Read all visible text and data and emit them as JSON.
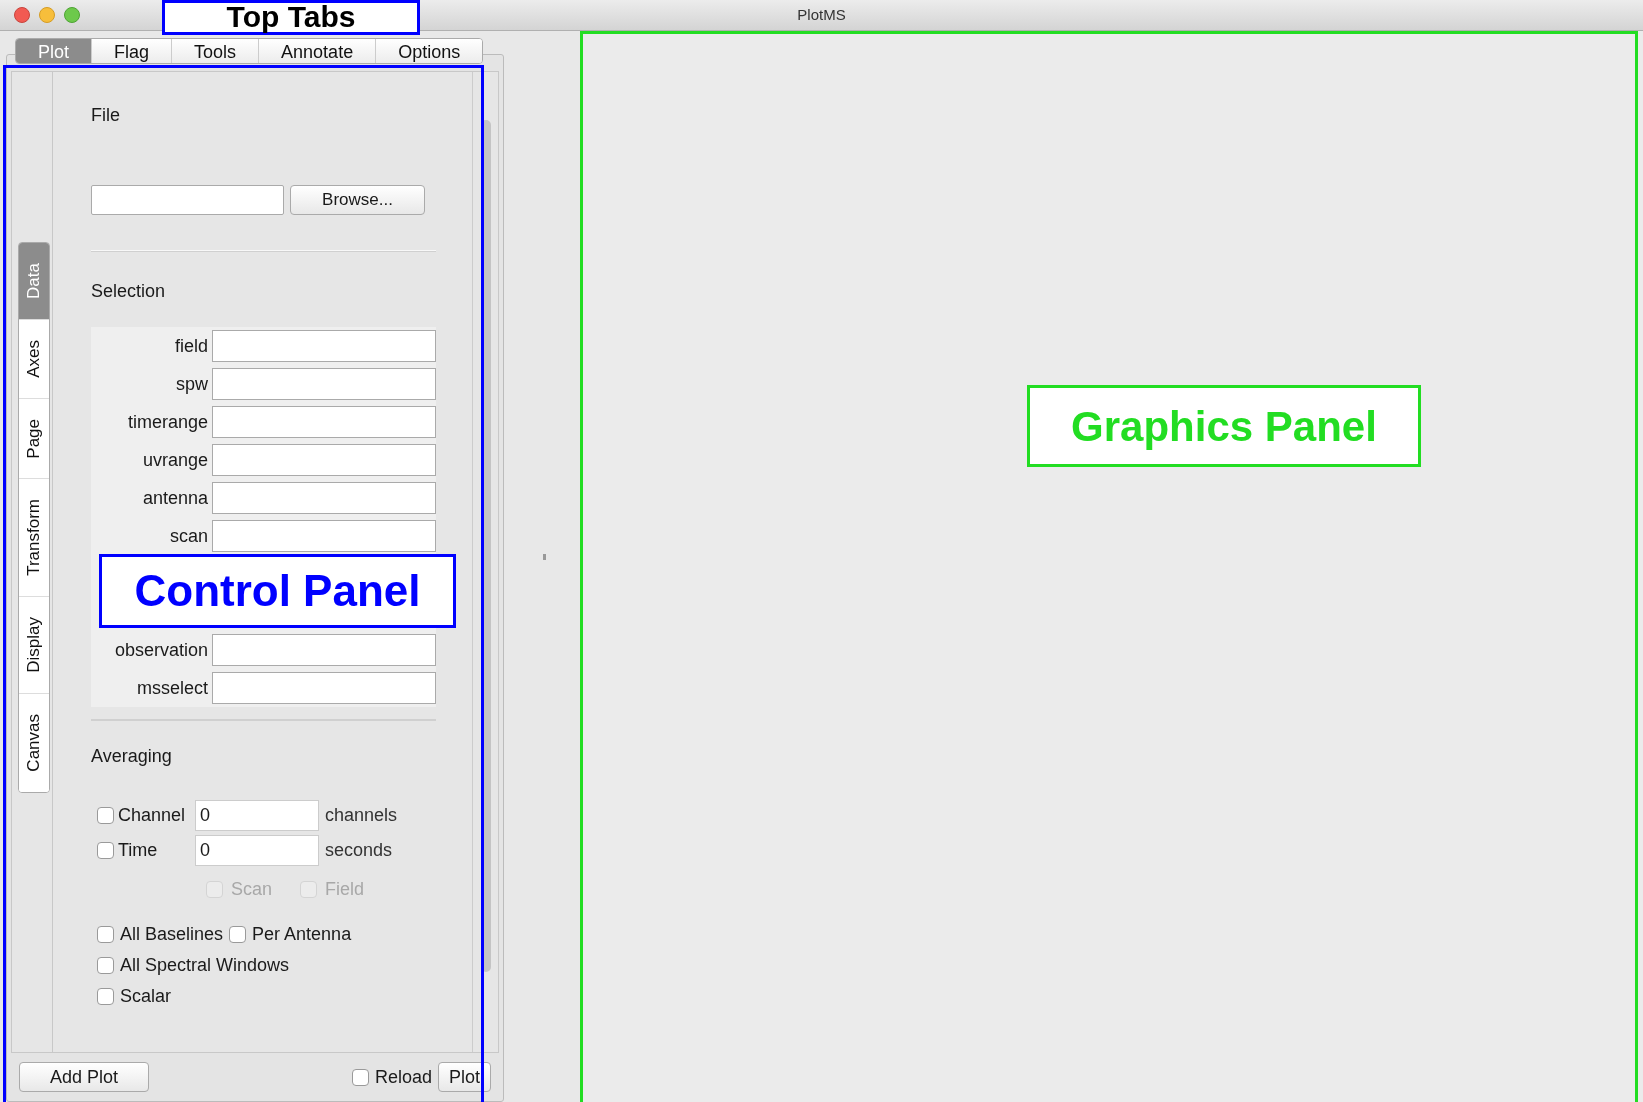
{
  "window": {
    "title": "PlotMS"
  },
  "top_tabs": [
    {
      "label": "Plot",
      "selected": true
    },
    {
      "label": "Flag",
      "selected": false
    },
    {
      "label": "Tools",
      "selected": false
    },
    {
      "label": "Annotate",
      "selected": false
    },
    {
      "label": "Options",
      "selected": false
    }
  ],
  "side_tabs": [
    {
      "label": "Data",
      "selected": true
    },
    {
      "label": "Axes",
      "selected": false
    },
    {
      "label": "Page",
      "selected": false
    },
    {
      "label": "Transform",
      "selected": false
    },
    {
      "label": "Display",
      "selected": false
    },
    {
      "label": "Canvas",
      "selected": false
    }
  ],
  "file_section": {
    "heading": "File",
    "button": "Browse..."
  },
  "selection": {
    "heading": "Selection",
    "fields": [
      {
        "label": "field"
      },
      {
        "label": "spw"
      },
      {
        "label": "timerange"
      },
      {
        "label": "uvrange"
      },
      {
        "label": "antenna"
      },
      {
        "label": "scan"
      },
      {
        "label": "observation"
      },
      {
        "label": "msselect"
      }
    ]
  },
  "averaging": {
    "heading": "Averaging",
    "rows": [
      {
        "label": "Channel",
        "checked": false,
        "value": "0",
        "unit": "channels"
      },
      {
        "label": "Time",
        "checked": false,
        "value": "0",
        "unit": "seconds"
      }
    ],
    "sub_options": [
      {
        "label": "Scan",
        "checked": false,
        "disabled": true
      },
      {
        "label": "Field",
        "checked": false,
        "disabled": true
      }
    ],
    "options": [
      [
        {
          "label": "All Baselines",
          "checked": false
        },
        {
          "label": "Per Antenna",
          "checked": false
        }
      ],
      [
        {
          "label": "All Spectral Windows",
          "checked": false
        }
      ],
      [
        {
          "label": "Scalar",
          "checked": false
        }
      ]
    ]
  },
  "footer": {
    "add_button": "Add Plot",
    "reload": {
      "label": "Reload",
      "checked": false
    },
    "plot_button": "Plot"
  },
  "annotations": [
    {
      "kind": "top",
      "label": "Top Tabs",
      "color": "#0000ff"
    },
    {
      "kind": "control",
      "label": "Control Panel",
      "color": "#0000ff"
    },
    {
      "kind": "graphics",
      "label": "Graphics Panel",
      "color": "#22dd22"
    }
  ]
}
